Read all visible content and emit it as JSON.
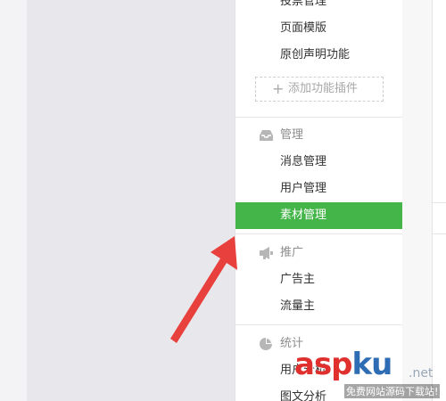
{
  "sidebar": {
    "top_items": [
      {
        "label": "投票管理"
      },
      {
        "label": "页面模版"
      },
      {
        "label": "原创声明功能"
      }
    ],
    "add_plugin": {
      "label": "添加功能插件",
      "icon": "plus-icon"
    },
    "sections": [
      {
        "title": "管理",
        "icon": "inbox-icon",
        "items": [
          {
            "label": "消息管理",
            "active": false
          },
          {
            "label": "用户管理",
            "active": false
          },
          {
            "label": "素材管理",
            "active": true
          }
        ]
      },
      {
        "title": "推广",
        "icon": "megaphone-icon",
        "items": [
          {
            "label": "广告主",
            "active": false
          },
          {
            "label": "流量主",
            "active": false
          }
        ]
      },
      {
        "title": "统计",
        "icon": "pie-chart-icon",
        "items": [
          {
            "label": "用户分析",
            "active": false
          },
          {
            "label": "图文分析",
            "active": false
          }
        ]
      }
    ]
  },
  "watermark": {
    "brand_red": "asp",
    "brand_blue": "ku",
    "net": ".net",
    "tagline": "免费网站源码下载站!"
  },
  "colors": {
    "active": "#44b549",
    "arrow": "#e8403c"
  }
}
